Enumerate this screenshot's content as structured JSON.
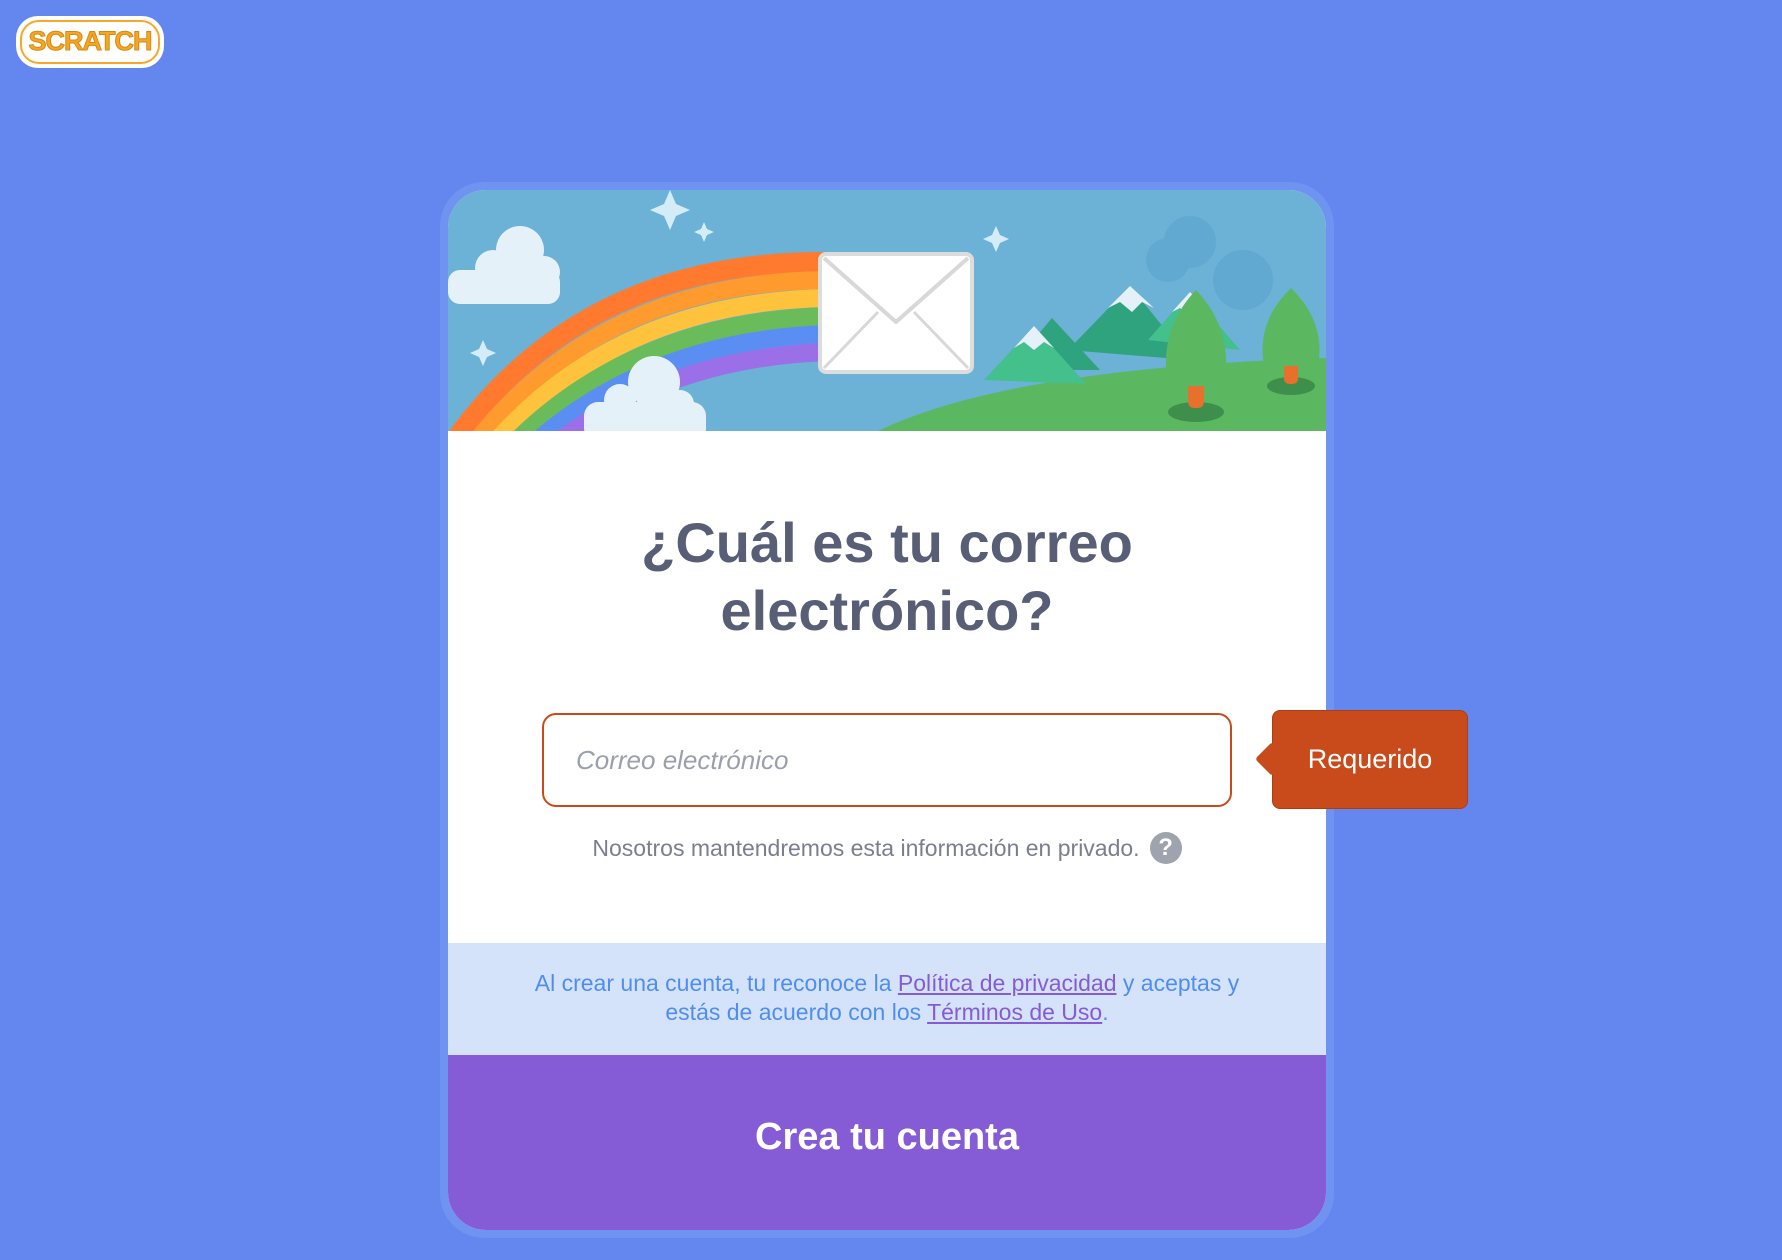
{
  "logo": {
    "text": "SCRATCH"
  },
  "form": {
    "title_line1": "¿Cuál es tu correo",
    "title_line2": "electrónico?",
    "email_value": "",
    "email_placeholder": "Correo electrónico",
    "privacy_note": "Nosotros mantendremos esta información en privado.",
    "help_glyph": "?",
    "required_tooltip": "Requerido"
  },
  "legal": {
    "text_before": "Al crear una cuenta, tu reconoce la ",
    "privacy_link": "Política de privacidad",
    "text_middle": " y aceptas y estás de acuerdo con los ",
    "terms_link": "Términos de Uso",
    "text_after": "."
  },
  "submit": {
    "label": "Crea tu cuenta"
  },
  "colors": {
    "page_background": "#6386ef",
    "error": "#c94b1b",
    "button": "#855cd6",
    "legal_background": "#d5e3fa",
    "title_text": "#575e75"
  },
  "icons": {
    "help": "question-circle-icon",
    "banner_envelope": "envelope-icon"
  }
}
